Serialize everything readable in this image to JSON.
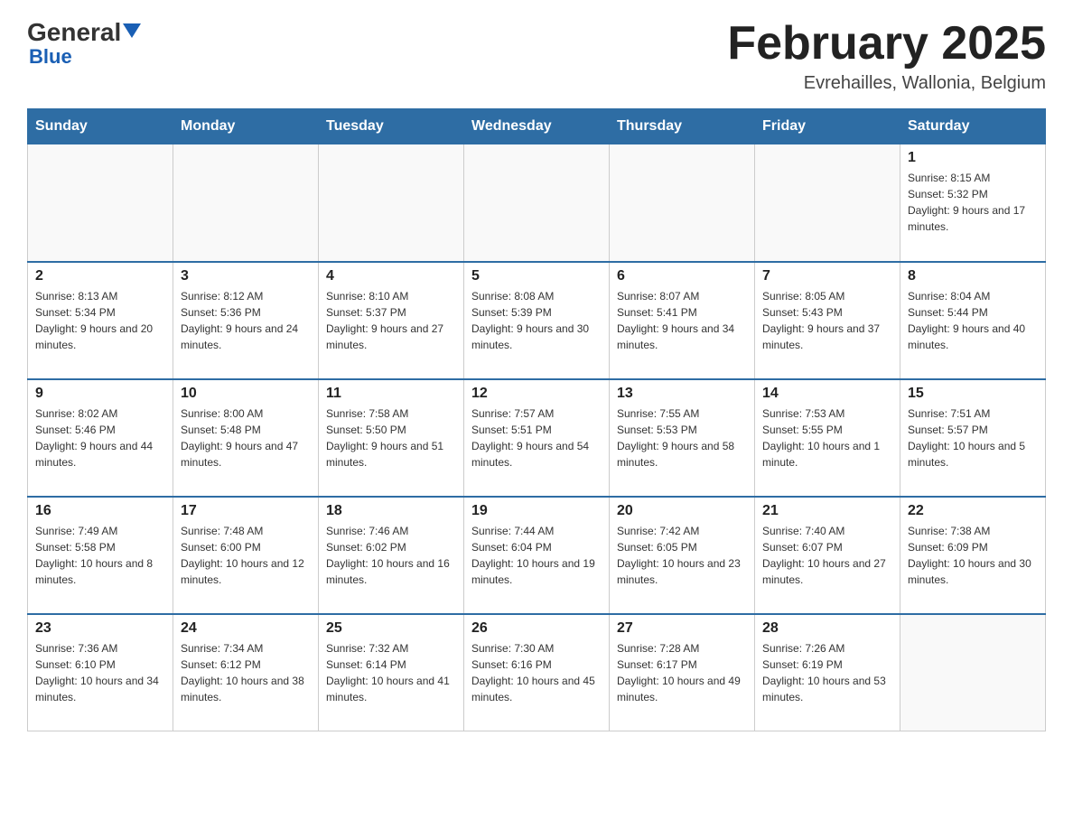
{
  "logo": {
    "general": "General",
    "blue": "Blue"
  },
  "title": "February 2025",
  "subtitle": "Evrehailles, Wallonia, Belgium",
  "days_of_week": [
    "Sunday",
    "Monday",
    "Tuesday",
    "Wednesday",
    "Thursday",
    "Friday",
    "Saturday"
  ],
  "weeks": [
    [
      {
        "day": "",
        "info": ""
      },
      {
        "day": "",
        "info": ""
      },
      {
        "day": "",
        "info": ""
      },
      {
        "day": "",
        "info": ""
      },
      {
        "day": "",
        "info": ""
      },
      {
        "day": "",
        "info": ""
      },
      {
        "day": "1",
        "info": "Sunrise: 8:15 AM\nSunset: 5:32 PM\nDaylight: 9 hours and 17 minutes."
      }
    ],
    [
      {
        "day": "2",
        "info": "Sunrise: 8:13 AM\nSunset: 5:34 PM\nDaylight: 9 hours and 20 minutes."
      },
      {
        "day": "3",
        "info": "Sunrise: 8:12 AM\nSunset: 5:36 PM\nDaylight: 9 hours and 24 minutes."
      },
      {
        "day": "4",
        "info": "Sunrise: 8:10 AM\nSunset: 5:37 PM\nDaylight: 9 hours and 27 minutes."
      },
      {
        "day": "5",
        "info": "Sunrise: 8:08 AM\nSunset: 5:39 PM\nDaylight: 9 hours and 30 minutes."
      },
      {
        "day": "6",
        "info": "Sunrise: 8:07 AM\nSunset: 5:41 PM\nDaylight: 9 hours and 34 minutes."
      },
      {
        "day": "7",
        "info": "Sunrise: 8:05 AM\nSunset: 5:43 PM\nDaylight: 9 hours and 37 minutes."
      },
      {
        "day": "8",
        "info": "Sunrise: 8:04 AM\nSunset: 5:44 PM\nDaylight: 9 hours and 40 minutes."
      }
    ],
    [
      {
        "day": "9",
        "info": "Sunrise: 8:02 AM\nSunset: 5:46 PM\nDaylight: 9 hours and 44 minutes."
      },
      {
        "day": "10",
        "info": "Sunrise: 8:00 AM\nSunset: 5:48 PM\nDaylight: 9 hours and 47 minutes."
      },
      {
        "day": "11",
        "info": "Sunrise: 7:58 AM\nSunset: 5:50 PM\nDaylight: 9 hours and 51 minutes."
      },
      {
        "day": "12",
        "info": "Sunrise: 7:57 AM\nSunset: 5:51 PM\nDaylight: 9 hours and 54 minutes."
      },
      {
        "day": "13",
        "info": "Sunrise: 7:55 AM\nSunset: 5:53 PM\nDaylight: 9 hours and 58 minutes."
      },
      {
        "day": "14",
        "info": "Sunrise: 7:53 AM\nSunset: 5:55 PM\nDaylight: 10 hours and 1 minute."
      },
      {
        "day": "15",
        "info": "Sunrise: 7:51 AM\nSunset: 5:57 PM\nDaylight: 10 hours and 5 minutes."
      }
    ],
    [
      {
        "day": "16",
        "info": "Sunrise: 7:49 AM\nSunset: 5:58 PM\nDaylight: 10 hours and 8 minutes."
      },
      {
        "day": "17",
        "info": "Sunrise: 7:48 AM\nSunset: 6:00 PM\nDaylight: 10 hours and 12 minutes."
      },
      {
        "day": "18",
        "info": "Sunrise: 7:46 AM\nSunset: 6:02 PM\nDaylight: 10 hours and 16 minutes."
      },
      {
        "day": "19",
        "info": "Sunrise: 7:44 AM\nSunset: 6:04 PM\nDaylight: 10 hours and 19 minutes."
      },
      {
        "day": "20",
        "info": "Sunrise: 7:42 AM\nSunset: 6:05 PM\nDaylight: 10 hours and 23 minutes."
      },
      {
        "day": "21",
        "info": "Sunrise: 7:40 AM\nSunset: 6:07 PM\nDaylight: 10 hours and 27 minutes."
      },
      {
        "day": "22",
        "info": "Sunrise: 7:38 AM\nSunset: 6:09 PM\nDaylight: 10 hours and 30 minutes."
      }
    ],
    [
      {
        "day": "23",
        "info": "Sunrise: 7:36 AM\nSunset: 6:10 PM\nDaylight: 10 hours and 34 minutes."
      },
      {
        "day": "24",
        "info": "Sunrise: 7:34 AM\nSunset: 6:12 PM\nDaylight: 10 hours and 38 minutes."
      },
      {
        "day": "25",
        "info": "Sunrise: 7:32 AM\nSunset: 6:14 PM\nDaylight: 10 hours and 41 minutes."
      },
      {
        "day": "26",
        "info": "Sunrise: 7:30 AM\nSunset: 6:16 PM\nDaylight: 10 hours and 45 minutes."
      },
      {
        "day": "27",
        "info": "Sunrise: 7:28 AM\nSunset: 6:17 PM\nDaylight: 10 hours and 49 minutes."
      },
      {
        "day": "28",
        "info": "Sunrise: 7:26 AM\nSunset: 6:19 PM\nDaylight: 10 hours and 53 minutes."
      },
      {
        "day": "",
        "info": ""
      }
    ]
  ]
}
